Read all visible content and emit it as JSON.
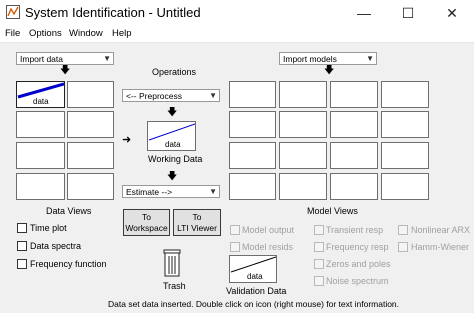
{
  "window": {
    "title": "System Identification - Untitled"
  },
  "menu": {
    "items": [
      "File",
      "Options",
      "Window",
      "Help"
    ]
  },
  "data_panel": {
    "import_value": "Import data",
    "cell_label": "data",
    "section_label": "Data Views"
  },
  "data_views": [
    "Time plot",
    "Data spectra",
    "Frequency function"
  ],
  "operations": {
    "label": "Operations",
    "preprocess_value": "<-- Preprocess",
    "working_data_cell": "data",
    "working_data_label": "Working Data",
    "estimate_value": "Estimate -->",
    "to_workspace": [
      "To",
      "Workspace"
    ],
    "to_lti_viewer": [
      "To",
      "LTI Viewer"
    ],
    "trash_label": "Trash",
    "validation_cell": "data",
    "validation_label": "Validation Data"
  },
  "models_panel": {
    "import_value": "Import models",
    "section_label": "Model Views"
  },
  "model_views": [
    "Model output",
    "Model resids",
    "Transient resp",
    "Frequency resp",
    "Zeros and poles",
    "Noise spectrum",
    "Nonlinear ARX",
    "Hamm-Wiener"
  ],
  "status": {
    "text": "Data set data inserted.  Double click on icon (right mouse) for text information."
  },
  "colors": {
    "data_line": "#0000cc",
    "titlebar_bg": "#ffffff",
    "window_bg": "#f0f0f0"
  }
}
